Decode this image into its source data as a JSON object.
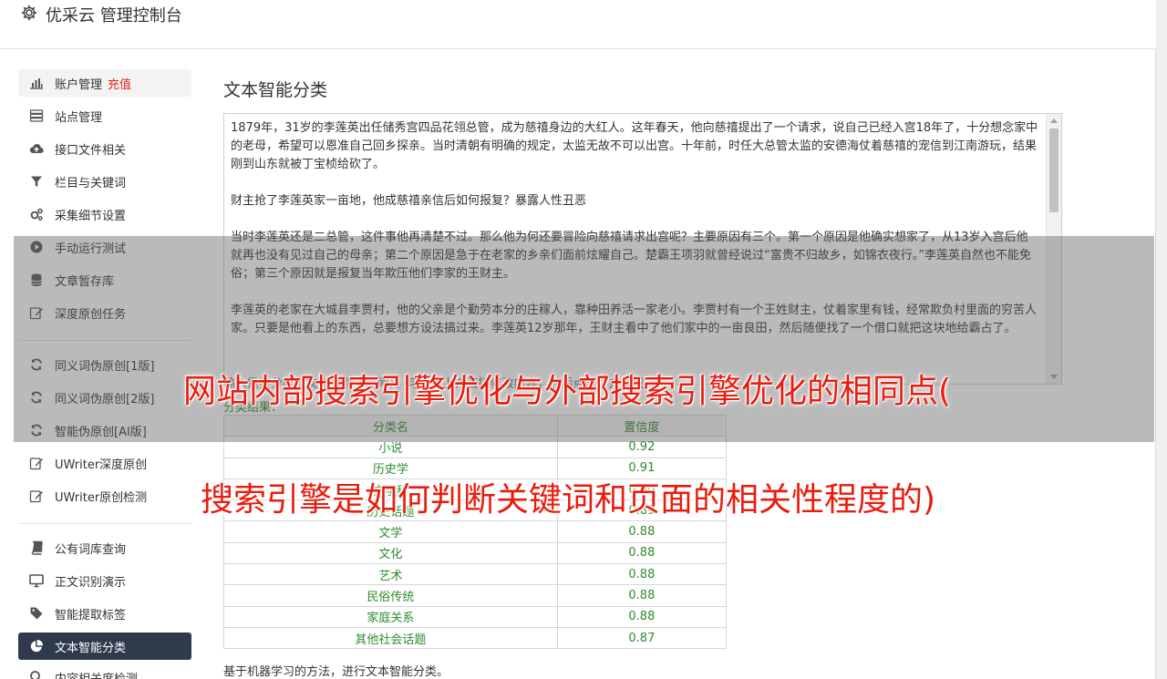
{
  "app": {
    "title": "优采云 管理控制台"
  },
  "sidebar": {
    "items": [
      {
        "label": "账户管理",
        "badge": "充值",
        "icon": "bar-chart-icon"
      },
      {
        "label": "站点管理",
        "icon": "server-icon"
      },
      {
        "label": "接口文件相关",
        "icon": "cloud-upload-icon"
      },
      {
        "label": "栏目与关键词",
        "icon": "filter-icon"
      },
      {
        "label": "采集细节设置",
        "icon": "cogs-icon"
      },
      {
        "label": "手动运行测试",
        "icon": "play-circle-icon"
      },
      {
        "label": "文章暂存库",
        "icon": "database-icon"
      },
      {
        "label": "深度原创任务",
        "icon": "edit-icon"
      },
      {
        "label": "同义词伪原创[1版]",
        "icon": "refresh-icon"
      },
      {
        "label": "同义词伪原创[2版]",
        "icon": "refresh-icon"
      },
      {
        "label": "智能伪原创[AI版]",
        "icon": "refresh-icon"
      },
      {
        "label": "UWriter深度原创",
        "icon": "edit-icon"
      },
      {
        "label": "UWriter原创检测",
        "icon": "edit-icon"
      },
      {
        "label": "公有词库查询",
        "icon": "book-icon"
      },
      {
        "label": "正文识别演示",
        "icon": "monitor-icon"
      },
      {
        "label": "智能提取标签",
        "icon": "tag-icon"
      },
      {
        "label": "文本智能分类",
        "icon": "pie-chart-icon"
      },
      {
        "label": "内容相关度检测",
        "icon": "search-icon"
      }
    ]
  },
  "main": {
    "title": "文本智能分类",
    "paragraphs": [
      "1879年，31岁的李莲英出任储秀宫四品花翎总管，成为慈禧身边的大红人。这年春天，他向慈禧提出了一个请求，说自己已经入宫18年了，十分想念家中的老母，希望可以恩准自己回乡探亲。当时清朝有明确的规定，太监无故不可以出宫。十年前，时任大总管太监的安德海仗着慈禧的宠信到江南游玩，结果刚到山东就被丁宝桢给砍了。",
      "财主抢了李莲英家一亩地，他成慈禧亲信后如何报复？暴露人性丑恶",
      "当时李莲英还是二总管，这件事他再清楚不过。那么他为何还要冒险向慈禧请求出宫呢？主要原因有三个。第一个原因是他确实想家了，从13岁入宫后他就再也没有见过自己的母亲；第二个原因是急于在老家的乡亲们面前炫耀自己。楚霸王项羽就曾经说过“富贵不归故乡，如锦衣夜行。”李莲英自然也不能免俗；第三个原因就是报复当年欺压他们李家的王财主。",
      "李莲英的老家在大城县李贾村，他的父亲是个勤劳本分的庄稼人，靠种田养活一家老小。李贾村有一个王姓财主，仗着家里有钱，经常欺负村里面的穷苦人家。只要是他看上的东西，总要想方设法搞过来。李莲英12岁那年，王财主看中了他们家中的一亩良田，然后随便找了一个借口就把这块地给霸占了。"
    ],
    "hint": "输入需要分类的文本（例如新闻），可以在上方直接修改内容，然后点击下方按钮",
    "result_label": "分类结果：",
    "table": {
      "headers": [
        "分类名",
        "置信度"
      ],
      "rows": [
        [
          "小说",
          "0.92"
        ],
        [
          "历史学",
          "0.91"
        ],
        [
          "文学科",
          "0.90"
        ],
        [
          "历史话题",
          "0.89"
        ],
        [
          "文学",
          "0.88"
        ],
        [
          "文化",
          "0.88"
        ],
        [
          "艺术",
          "0.88"
        ],
        [
          "民俗传统",
          "0.88"
        ],
        [
          "家庭关系",
          "0.88"
        ],
        [
          "其他社会话题",
          "0.87"
        ]
      ]
    },
    "footnote": "基于机器学习的方法，进行文本智能分类。"
  },
  "overlay": {
    "line1": "网站内部搜索引擎优化与外部搜索引擎优化的相同点(",
    "line2": "搜索引擎是如何判断关键词和页面的相关性程度的)"
  },
  "colors": {
    "accent_active": "#2f3b4c",
    "result_green": "#2e8b2e",
    "badge_red": "#e1261c",
    "headline_red": "#ea1c0d"
  }
}
